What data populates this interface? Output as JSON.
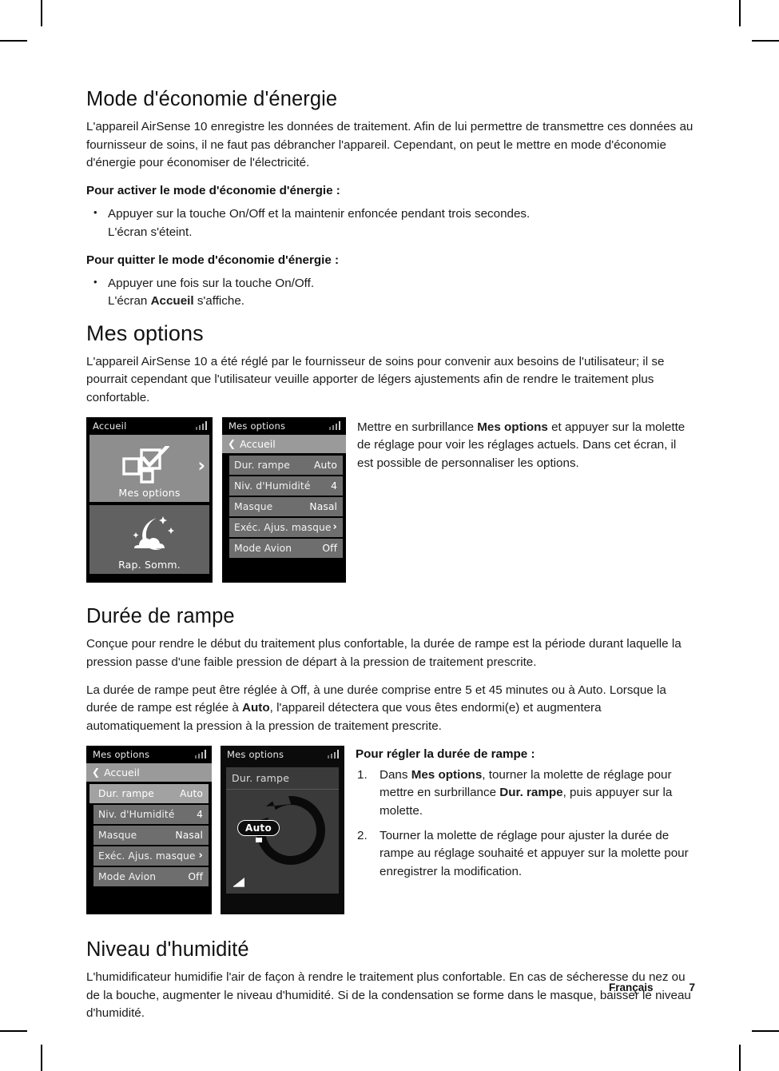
{
  "page": {
    "sections": [
      {
        "heading": "Mode d'économie d'énergie",
        "paragraph": "L'appareil AirSense 10 enregistre les données de traitement. Afin de lui permettre de transmettre ces données au fournisseur de soins, il ne faut pas débrancher l'appareil. Cependant, on peut le mettre en mode d'économie d'énergie pour économiser de l'électricité."
      }
    ],
    "activate_lead": "Pour activer le mode d'économie d'énergie :",
    "activate_bullet_main": "Appuyer sur la touche On/Off et la maintenir enfoncée pendant trois secondes.",
    "activate_bullet_sub": "L'écran s'éteint.",
    "quit_lead": "Pour quitter le mode d'économie d'énergie :",
    "quit_bullet_main": "Appuyer une fois sur la touche On/Off.",
    "quit_bullet_sub_pre": "L'écran ",
    "quit_bullet_sub_bold": "Accueil",
    "quit_bullet_sub_post": " s'affiche.",
    "mes_options_heading": "Mes options",
    "mes_options_paragraph": "L'appareil AirSense 10 a été réglé par le fournisseur de soins pour convenir aux besoins de l'utilisateur; il se pourrait cependant que l'utilisateur veuille apporter de légers ajustements afin de rendre le traitement plus confortable.",
    "mes_options_side_pre": "Mettre en surbrillance ",
    "mes_options_side_bold": "Mes options",
    "mes_options_side_post": " et appuyer sur la molette de réglage pour voir les réglages actuels. Dans cet écran, il est possible de personnaliser les options.",
    "ramp_heading": "Durée de rampe",
    "ramp_paragraph_1": "Conçue pour rendre le début du traitement plus confortable, la durée de rampe est la période durant laquelle la pression passe d'une faible pression de départ à la pression de traitement prescrite.",
    "ramp_paragraph_2_pre": "La durée de rampe peut être réglée à Off, à une durée comprise entre 5 et 45 minutes ou à Auto. Lorsque la durée de rampe est réglée à ",
    "ramp_paragraph_2_bold": "Auto",
    "ramp_paragraph_2_post": ", l'appareil détectera que vous êtes endormi(e) et augmentera automatiquement la pression à la pression de traitement prescrite.",
    "ramp_steps_lead": "Pour régler la durée de rampe :",
    "ramp_step_1_pre": "Dans ",
    "ramp_step_1_bold_1": "Mes options",
    "ramp_step_1_mid": ", tourner la molette de réglage pour mettre en surbrillance ",
    "ramp_step_1_bold_2": "Dur. rampe",
    "ramp_step_1_post": ", puis appuyer sur la molette.",
    "ramp_step_2": "Tourner la molette de réglage pour ajuster la durée de rampe au réglage souhaité et appuyer sur la molette pour enregistrer la modification.",
    "humidity_heading": "Niveau d'humidité",
    "humidity_paragraph": "L'humidificateur humidifie l'air de façon à rendre le traitement plus confortable. En cas de sécheresse du nez ou de la bouche, augmenter le niveau d'humidité. Si de la condensation se forme dans le masque, baisser le niveau d'humidité."
  },
  "screens": {
    "home": {
      "title": "Accueil",
      "signal_icon": "signal-bars-icon",
      "tiles": [
        {
          "label": "Mes options",
          "icon": "checkbox-options-icon",
          "chevron": "›"
        },
        {
          "label": "Rap. Somm.",
          "icon": "moon-cloud-icon"
        }
      ]
    },
    "my_options": {
      "title": "Mes options",
      "back_label": "Accueil",
      "back_icon": "chevron-left-icon",
      "rows": [
        {
          "label": "Dur. rampe",
          "value": "Auto"
        },
        {
          "label": "Niv. d'Humidité",
          "value": "4"
        },
        {
          "label": "Masque",
          "value": "Nasal"
        },
        {
          "label": "Exéc. Ajus. masque",
          "value": "›"
        },
        {
          "label": "Mode Avion",
          "value": "Off"
        }
      ]
    },
    "my_options_highlighted": {
      "title": "Mes options",
      "back_label": "Accueil",
      "rows": [
        {
          "label": "Dur. rampe",
          "value": "Auto",
          "highlighted": true
        },
        {
          "label": "Niv. d'Humidité",
          "value": "4"
        },
        {
          "label": "Masque",
          "value": "Nasal"
        },
        {
          "label": "Exéc. Ajus. masque",
          "value": "›"
        },
        {
          "label": "Mode Avion",
          "value": "Off"
        }
      ]
    },
    "ramp_dial": {
      "title": "Mes options",
      "field_label": "Dur. rampe",
      "value": "Auto",
      "dial_icon": "ramp-dial-icon",
      "ramp_icon": "ramp-up-icon"
    }
  },
  "footer": {
    "language": "Français",
    "page_number": "7"
  }
}
